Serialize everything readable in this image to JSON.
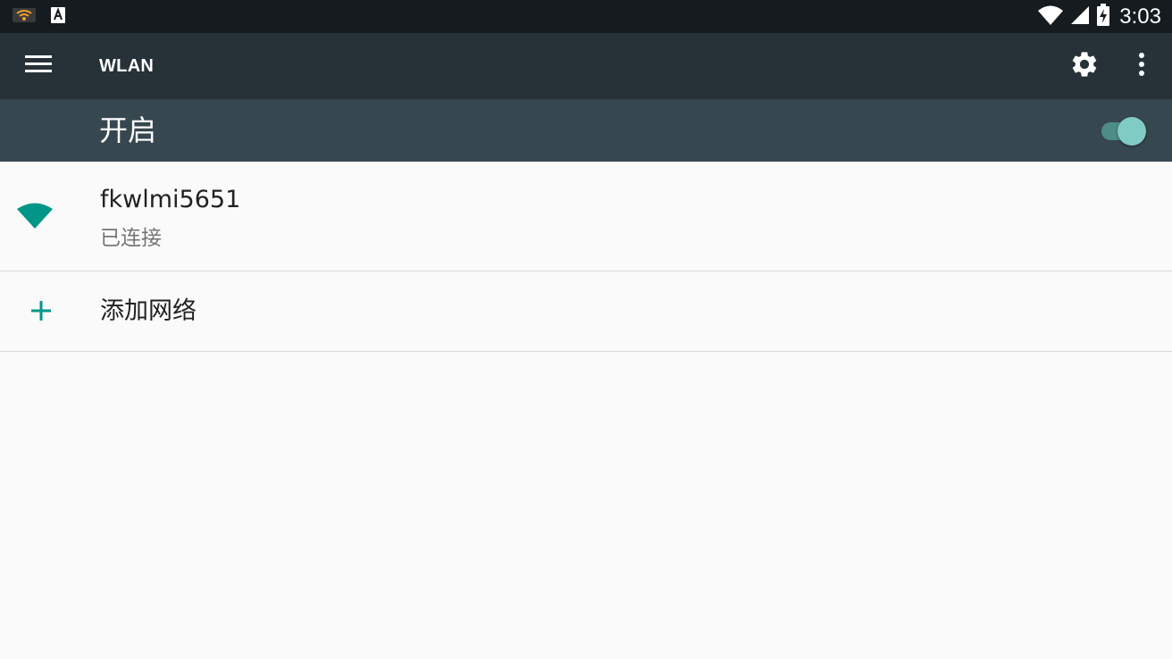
{
  "status_bar": {
    "time": "3:03",
    "left_icons": [
      "wifi-notification-icon",
      "a-keyboard-icon"
    ],
    "right_icons": [
      "wifi-signal-icon",
      "cellular-signal-icon",
      "battery-charging-icon"
    ]
  },
  "app_bar": {
    "title": "WLAN",
    "menu_icon": "menu-icon",
    "settings_icon": "gear-icon",
    "overflow_icon": "more-vert-icon"
  },
  "master_switch": {
    "label": "开启",
    "enabled": true
  },
  "networks": [
    {
      "ssid": "fkwlmi5651",
      "status": "已连接",
      "icon": "wifi-icon"
    }
  ],
  "add_network": {
    "label": "添加网络",
    "icon": "plus-icon"
  },
  "colors": {
    "status_bar": "#151b1f",
    "app_bar": "#263238",
    "switch_bar": "#37474f",
    "accent": "#009688",
    "background": "#fafafa"
  }
}
